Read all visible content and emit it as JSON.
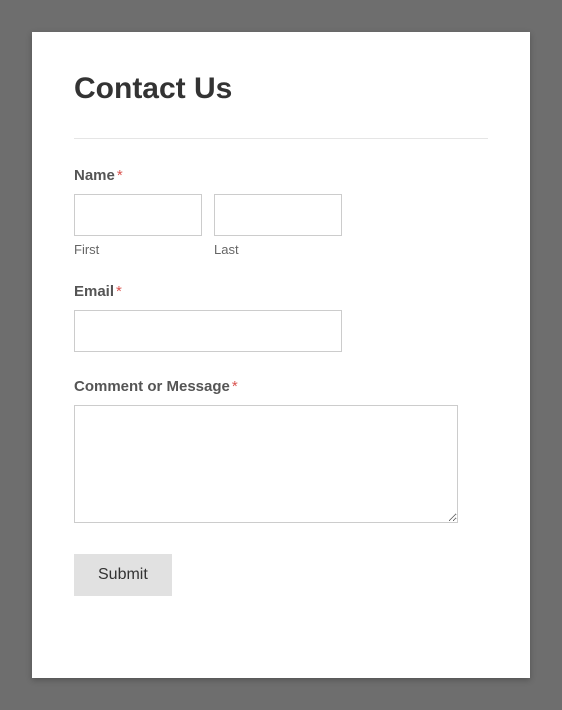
{
  "form": {
    "title": "Contact Us",
    "required_marker": "*",
    "fields": {
      "name": {
        "label": "Name",
        "first_sublabel": "First",
        "last_sublabel": "Last",
        "first_value": "",
        "last_value": ""
      },
      "email": {
        "label": "Email",
        "value": ""
      },
      "message": {
        "label": "Comment or Message",
        "value": ""
      }
    },
    "submit_label": "Submit"
  }
}
